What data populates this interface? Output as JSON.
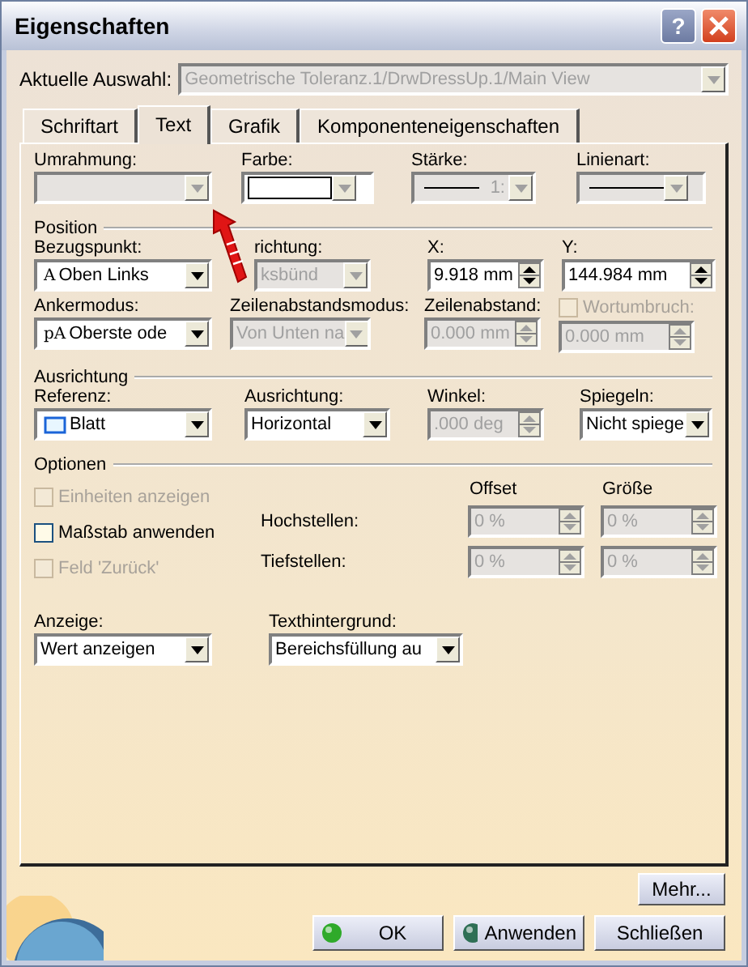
{
  "window": {
    "title": "Eigenschaften",
    "help_button": "?"
  },
  "current_selection": {
    "label": "Aktuelle Auswahl:",
    "value": "Geometrische Toleranz.1/DrwDressUp.1/Main View",
    "disabled": true
  },
  "tabs": [
    {
      "label": "Schriftart",
      "selected": false
    },
    {
      "label": "Text",
      "selected": true
    },
    {
      "label": "Grafik",
      "selected": false
    },
    {
      "label": "Komponenteneigenschaften",
      "selected": false
    }
  ],
  "top_row": [
    {
      "kind": "combo",
      "label": "Umrahmung:",
      "disabled": true
    },
    {
      "kind": "color",
      "label": "Farbe:",
      "disabled": false
    },
    {
      "kind": "line",
      "label": "Stärke:",
      "value": "1:",
      "disabled": true
    },
    {
      "kind": "line",
      "label": "Linienart:",
      "disabled": true
    }
  ],
  "sections": [
    {
      "title": "Position",
      "rows": [
        [
          {
            "kind": "combo",
            "label": "Bezugspunkt:",
            "icon": "A",
            "value": "Oben Links",
            "disabled": false
          },
          {
            "kind": "combo",
            "label": "richtung:",
            "value": "ksbünd",
            "disabled": true
          },
          {
            "kind": "spin",
            "label": "X:",
            "value": "9.918 mm",
            "disabled": false
          },
          {
            "kind": "spin",
            "label": "Y:",
            "value": "144.984 mm",
            "disabled": false
          }
        ],
        [
          {
            "kind": "combo",
            "label": "Ankermodus:",
            "icon": "pA",
            "value": "Oberste ode",
            "disabled": false
          },
          {
            "kind": "combo",
            "label": "Zeilenabstandsmodus:",
            "value": "Von Unten na",
            "disabled": true
          },
          {
            "kind": "spin",
            "label": "Zeilenabstand:",
            "value": "0.000 mm",
            "disabled": true
          },
          {
            "kind": "checkspin",
            "label": "Wortumbruch:",
            "checked": false,
            "value": "0.000 mm",
            "disabled": true
          }
        ]
      ]
    },
    {
      "title": "Ausrichtung",
      "rows": [
        [
          {
            "kind": "combo",
            "label": "Referenz:",
            "sheet_icon": true,
            "value": "Blatt",
            "disabled": false
          },
          {
            "kind": "combo",
            "label": "Ausrichtung:",
            "value": "Horizontal",
            "disabled": false
          },
          {
            "kind": "spin",
            "label": "Winkel:",
            "value": ".000 deg",
            "disabled": true
          },
          {
            "kind": "combo",
            "label": "Spiegeln:",
            "value": "Nicht spiege",
            "disabled": false
          }
        ]
      ]
    }
  ],
  "options": {
    "title": "Optionen",
    "checkboxes": [
      {
        "label": "Einheiten anzeigen",
        "checked": false,
        "disabled": true
      },
      {
        "label": "Maßstab anwenden",
        "checked": false,
        "disabled": false
      },
      {
        "label": "Feld 'Zurück'",
        "checked": false,
        "disabled": true
      }
    ],
    "columns": [
      "Offset",
      "Größe"
    ],
    "rows": [
      {
        "label": "Hochstellen:",
        "values": [
          "0 %",
          "0 %"
        ],
        "disabled": true
      },
      {
        "label": "Tiefstellen:",
        "values": [
          "0 %",
          "0 %"
        ],
        "disabled": true
      }
    ]
  },
  "bottom_row": [
    {
      "kind": "combo",
      "label": "Anzeige:",
      "value": "Wert anzeigen",
      "disabled": false
    },
    {
      "kind": "combo",
      "label": "Texthintergrund:",
      "value": "Bereichsfüllung au",
      "disabled": false
    }
  ],
  "more_button": "Mehr...",
  "buttons": [
    {
      "label": "OK",
      "kind": "ok"
    },
    {
      "label": "Anwenden",
      "kind": "apply"
    },
    {
      "label": "Schließen",
      "kind": "close"
    }
  ]
}
